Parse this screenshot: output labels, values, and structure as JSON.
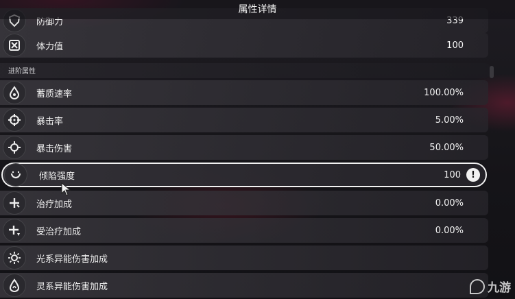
{
  "title": "属性详情",
  "section_label": "进阶属性",
  "rows": [
    {
      "label": "防御力",
      "value": "339",
      "icon": "shield-icon"
    },
    {
      "label": "体力值",
      "value": "100",
      "icon": "stamina-icon"
    },
    {
      "label": "蓄质速率",
      "value": "100.00%",
      "icon": "energy-drop-icon"
    },
    {
      "label": "暴击率",
      "value": "5.00%",
      "icon": "crosshair-icon"
    },
    {
      "label": "暴击伤害",
      "value": "50.00%",
      "icon": "crit-damage-icon"
    },
    {
      "label": "倾陷强度",
      "value": "100",
      "icon": "break-icon"
    },
    {
      "label": "治疗加成",
      "value": "0.00%",
      "icon": "heal-plus-icon"
    },
    {
      "label": "受治疗加成",
      "value": "0.00%",
      "icon": "heal-received-icon"
    },
    {
      "label": "光系异能伤害加成",
      "value": "",
      "icon": "light-element-icon"
    },
    {
      "label": "灵系异能伤害加成",
      "value": "",
      "icon": "spirit-element-icon"
    }
  ],
  "selected_info_symbol": "!",
  "watermark": "九游",
  "colors": {
    "highlight_border": "#f2f2f2",
    "row_bg": "#3a383e"
  }
}
